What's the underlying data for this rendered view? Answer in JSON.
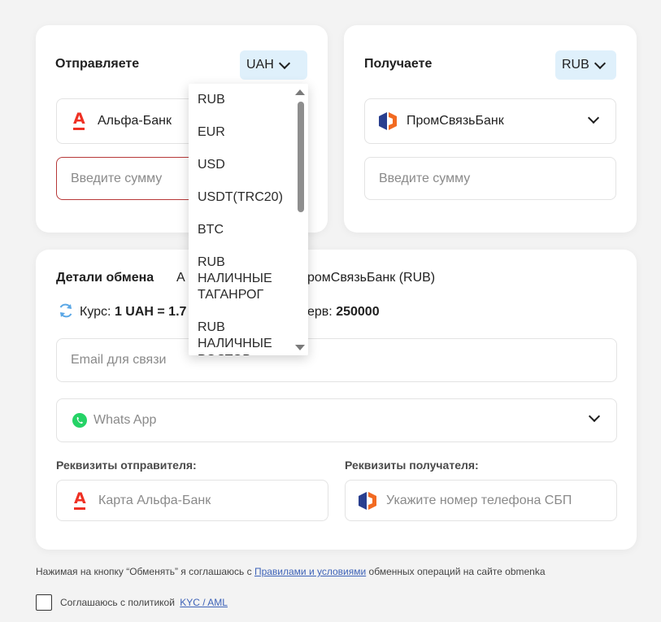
{
  "send": {
    "title": "Отправляете",
    "currency": "UAH",
    "bank": "Альфа-Банк",
    "amount_placeholder": "Введите сумму"
  },
  "receive": {
    "title": "Получаете",
    "currency": "RUB",
    "bank": "ПромСвязьБанк",
    "amount_placeholder": "Введите сумму"
  },
  "currency_dropdown": {
    "options": [
      "RUB",
      "EUR",
      "USD",
      "USDT(TRC20)",
      "BTC",
      "RUB НАЛИЧНЫЕ ТАГАНРОГ",
      "RUB НАЛИЧНЫЕ РОСТОВ"
    ]
  },
  "details": {
    "title": "Детали обмена",
    "route_left": "А",
    "route_right": "ромСвязьБанк (RUB)",
    "rate_prefix": "Курс:",
    "rate_value": "1 UAH = 1.7",
    "reserve_prefix": "ерв:",
    "reserve_value": "250000",
    "email_placeholder": "Email для связи",
    "messenger": "Whats App",
    "sender_label": "Реквизиты отправителя:",
    "receiver_label": "Реквизиты получателя:",
    "sender_placeholder": "Карта Альфа-Банк",
    "receiver_placeholder": "Укажите номер телефона СБП"
  },
  "footer": {
    "terms_before": "Нажимая на кнопку “Обменять” я соглашаюсь с ",
    "terms_link": "Правилами и условиями",
    "terms_after": " обменных операций на сайте obmenka",
    "policy_text": "Соглашаюсь с политикой",
    "policy_link": "KYC / AML"
  },
  "colors": {
    "accent_bg": "#dff0fb",
    "error_border": "#b73838",
    "alfa_red": "#ef3124",
    "psb_blue": "#2a3f8f",
    "psb_orange": "#f26a21",
    "whatsapp_green": "#25d366",
    "link": "#3e63b8"
  },
  "icons": {
    "alfa": "alfa-bank-icon",
    "psb": "psb-bank-icon",
    "refresh": "refresh-icon",
    "whatsapp": "whatsapp-icon"
  }
}
